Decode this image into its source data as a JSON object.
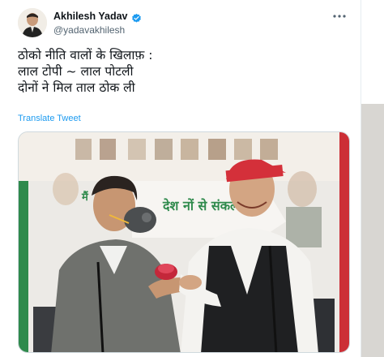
{
  "tweet": {
    "author": {
      "display_name": "Akhilesh Yadav",
      "handle": "@yadavakhilesh",
      "verified": true
    },
    "text_lines": [
      "ठोको नीति वालों के खिलाफ़ :",
      "लाल टोपी ~ लाल पोटली",
      "दोनों ने मिल ताल ठोक ली"
    ],
    "translate_label": "Translate Tweet",
    "media": {
      "banner_text": "देश नों से संकल्प",
      "banner_prefix": "मैं"
    }
  },
  "colors": {
    "link": "#1d9bf0",
    "verified": "#1d9bf0",
    "handle": "#536471",
    "red_cap": "#d4303a",
    "banner_green": "#2f8a4c"
  },
  "icons": {
    "verified": "verified-badge-icon",
    "more": "more-horizontal-icon"
  }
}
